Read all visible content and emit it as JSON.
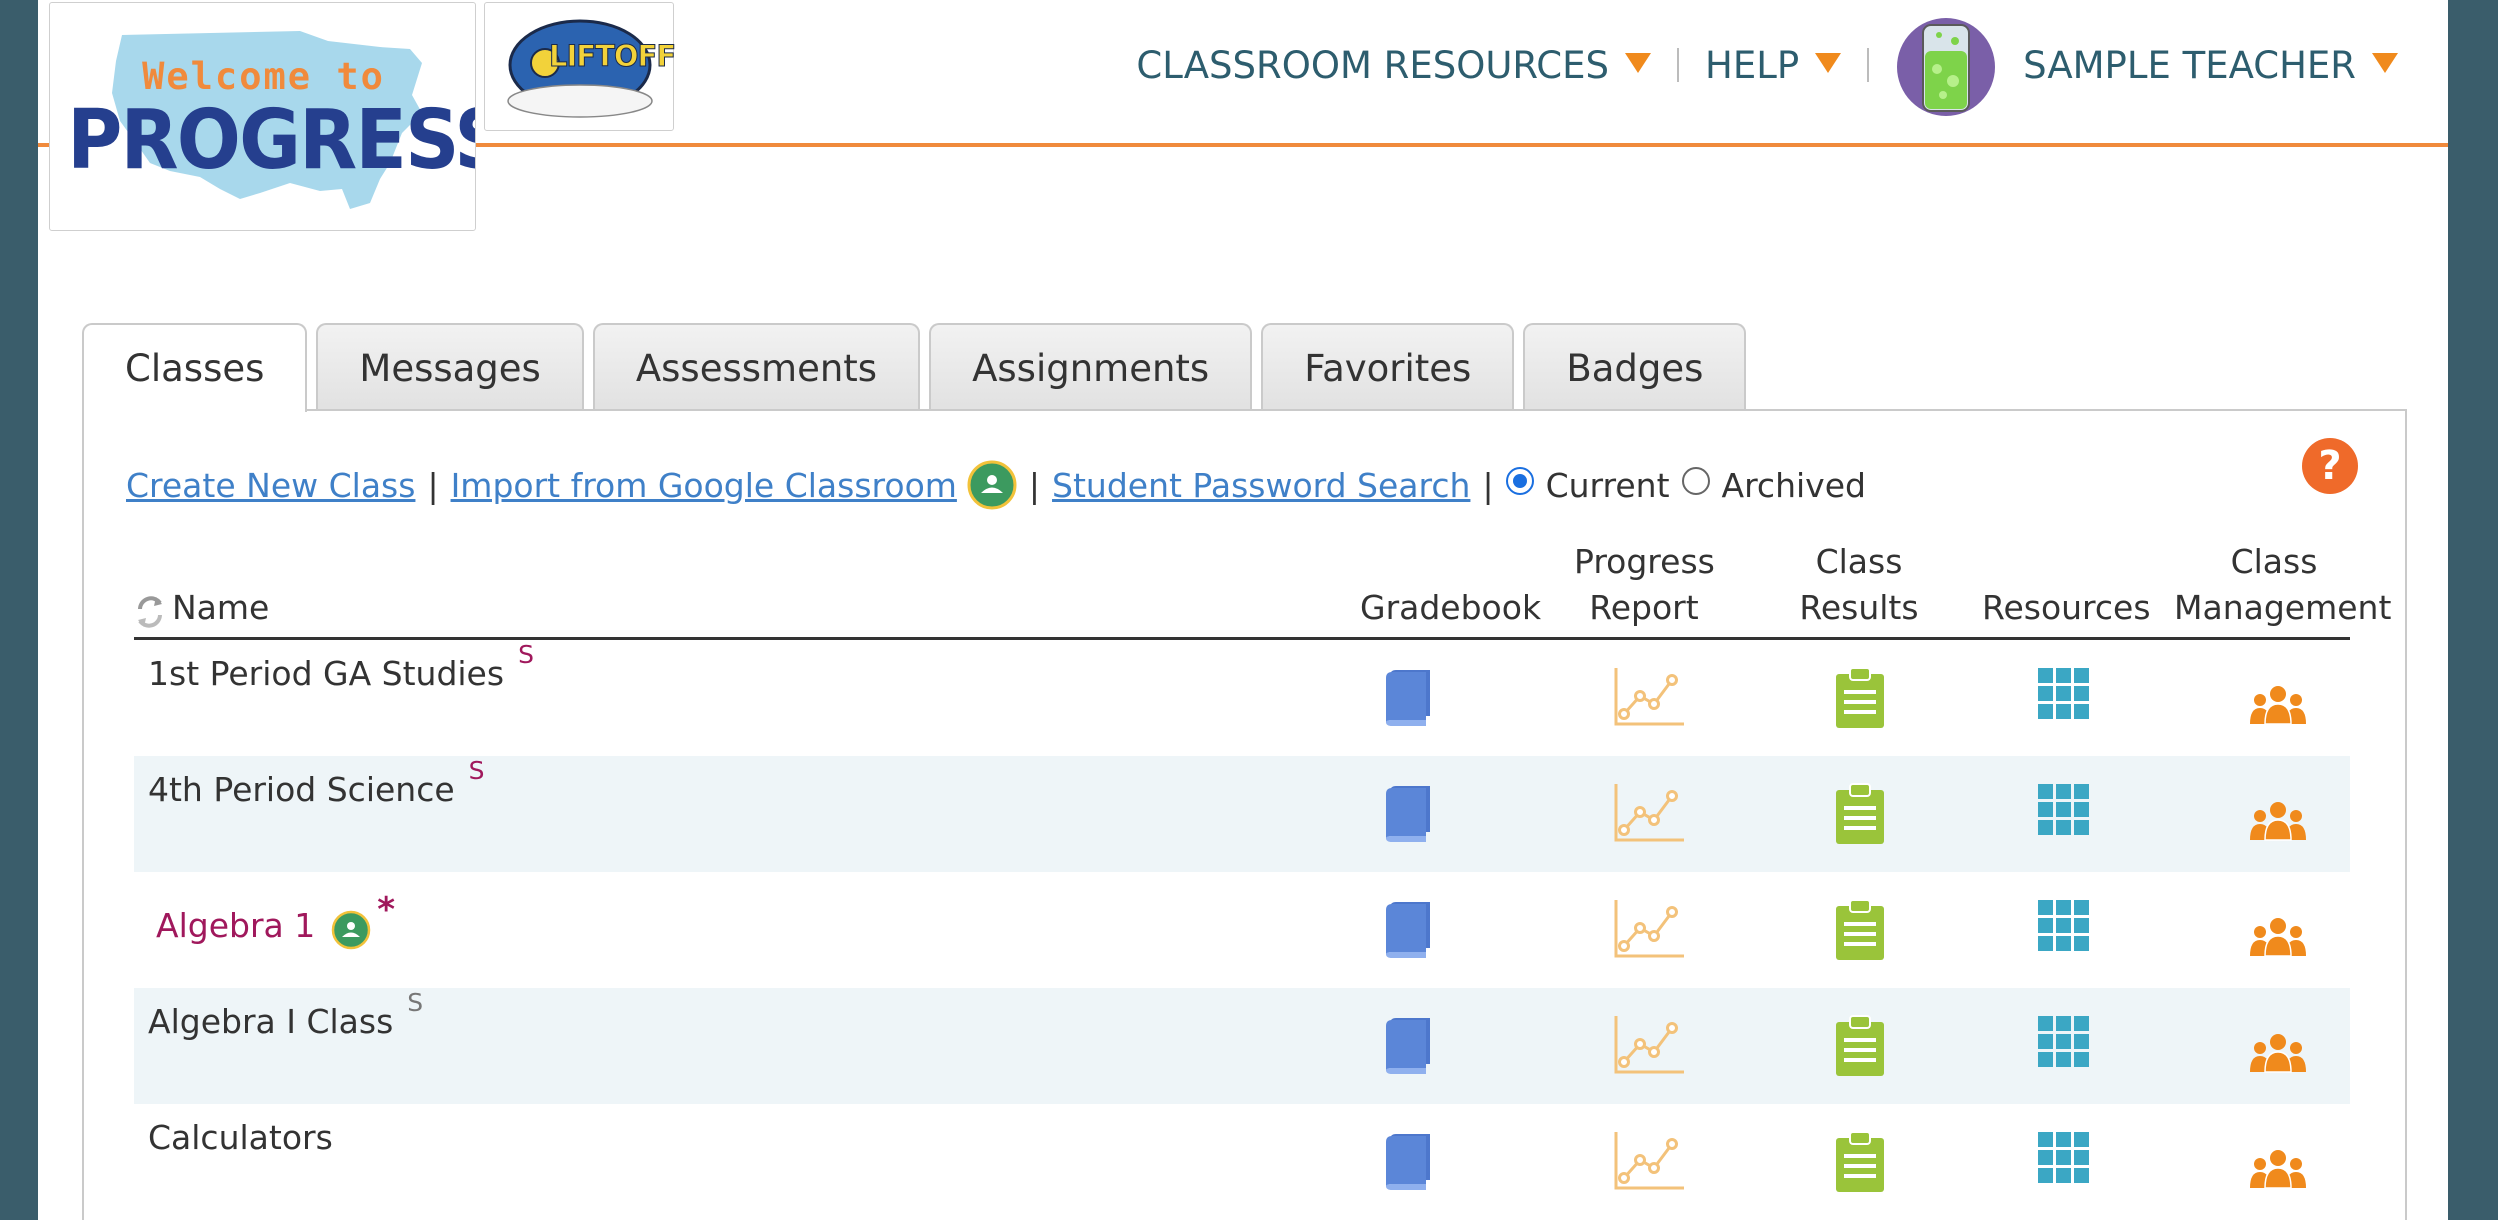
{
  "header": {
    "logo": {
      "line1": "Welcome to",
      "line2": "PROGRESS"
    },
    "liftoff_logo_text": "LIFTOFF",
    "nav": [
      {
        "label": "CLASSROOM RESOURCES"
      },
      {
        "label": "HELP"
      },
      {
        "label": "SAMPLE TEACHER"
      }
    ]
  },
  "tabs": [
    {
      "label": "Classes",
      "active": true
    },
    {
      "label": "Messages"
    },
    {
      "label": "Assessments"
    },
    {
      "label": "Assignments"
    },
    {
      "label": "Favorites"
    },
    {
      "label": "Badges"
    }
  ],
  "toolbar": {
    "create_new_class": "Create New Class",
    "import_google": "Import from Google Classroom",
    "student_password_search": "Student Password Search",
    "separator": "|",
    "filter_current": "Current",
    "filter_archived": "Archived",
    "selected_filter": "Current"
  },
  "table": {
    "headers": {
      "name": "Name",
      "gradebook": "Gradebook",
      "progress_report_1": "Progress",
      "progress_report_2": "Report",
      "class_results": "Class Results",
      "resources": "Resources",
      "class_management_1": "Class",
      "class_management_2": "Management"
    },
    "rows": [
      {
        "name": "1st Period GA Studies",
        "marker": "S",
        "marker_color": "pink"
      },
      {
        "name": "4th Period Science",
        "marker": "S",
        "marker_color": "pink"
      },
      {
        "name": "Algebra 1",
        "marker": "*",
        "google": true,
        "pink_name": true
      },
      {
        "name": "Algebra I Class",
        "marker": "S",
        "marker_color": "gray"
      },
      {
        "name": "Calculators",
        "marker": ""
      }
    ]
  },
  "colors": {
    "accent_orange": "#f08a3c",
    "nav_text": "#2d5d6e",
    "link": "#3f80c8",
    "gradebook_icon": "#5b86d8",
    "progress_icon": "#f3c27a",
    "class_results_icon": "#9ac43a",
    "resources_icon": "#3ba7c4",
    "class_management_icon": "#f08a1c",
    "pink_text": "#a0185c"
  },
  "icons": {
    "help": "question-icon",
    "google_classroom": "google-classroom-icon",
    "gradebook": "book-icon",
    "progress_report": "line-chart-icon",
    "class_results": "clipboard-icon",
    "resources": "grid-icon",
    "class_management": "people-icon",
    "sort": "sort-refresh-icon"
  }
}
